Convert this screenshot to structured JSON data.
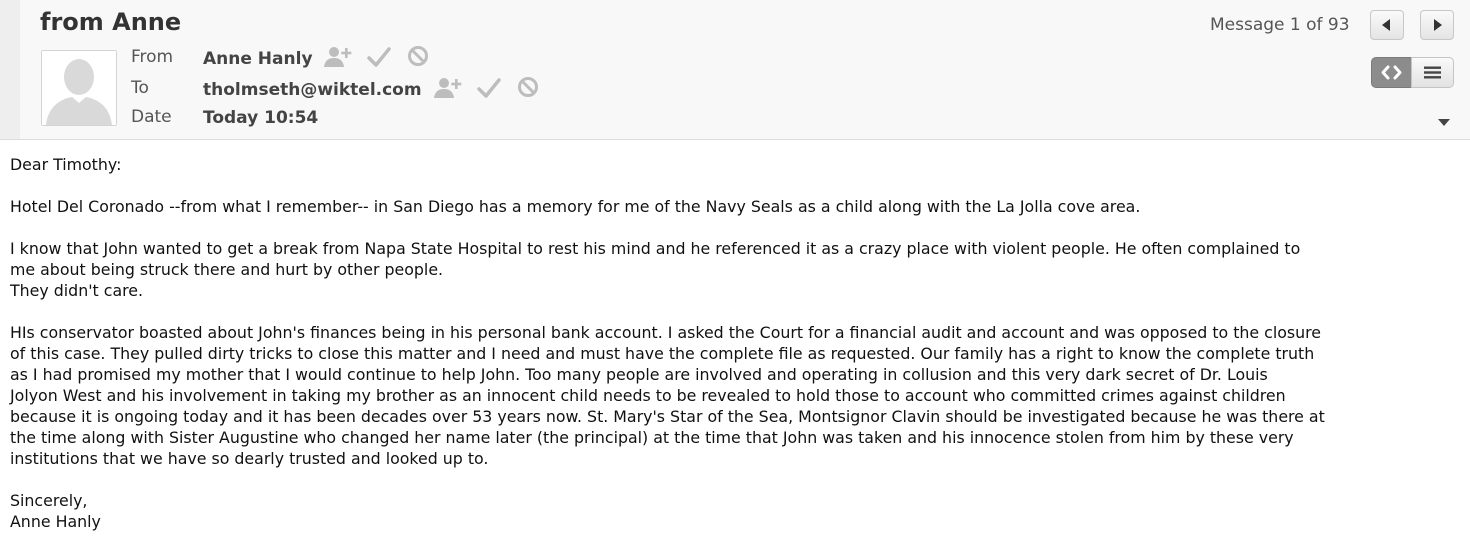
{
  "message": {
    "subject": "from Anne",
    "from_label": "From",
    "from_name": "Anne Hanly",
    "to_label": "To",
    "to_address": "tholmseth@wiktel.com",
    "date_label": "Date",
    "date_value": "Today 10:54"
  },
  "navigation": {
    "counter": "Message 1 of 93",
    "prev_icon": "triangle-left-icon",
    "next_icon": "triangle-right-icon"
  },
  "view_toggle": {
    "left_icon": "code-brackets-icon",
    "right_icon": "lines-icon",
    "active": "left"
  },
  "contact_icons": [
    "add-contact-icon",
    "checkmark-icon",
    "block-icon"
  ],
  "expand_icon": "caret-down-icon",
  "body": {
    "greeting": "Dear Timothy:",
    "para1": "Hotel Del Coronado --from what I remember-- in San Diego has a memory for me of the Navy Seals as a child along with the La Jolla cove area.",
    "para2_lines": [
      "I know that John wanted to get a break from Napa State Hospital to rest his mind and he referenced it as a crazy place with violent people.  He often complained to",
      "me about being struck there and hurt by other people.",
      "They didn't care."
    ],
    "para3_lines": [
      "HIs conservator boasted about John's finances being in his personal bank account.  I asked the Court for a financial audit and account and was opposed to the closure",
      "of this case.  They pulled dirty tricks to close this matter and I need and must have the complete file as requested.  Our family has a right to know the complete truth",
      "as I had promised my mother that I would continue to help John.  Too many people are involved and operating in collusion and this very dark secret of Dr. Louis",
      "Jolyon West and his involvement in taking my brother as an innocent child needs to be revealed to hold those to account who committed crimes against children",
      "because it is ongoing today and it has been decades over 53 years now.  St. Mary's Star of the Sea, Montsignor Clavin should be investigated because he was there at",
      "the time along with Sister Augustine who changed her name later (the principal) at the time that John was taken and his innocence stolen from him by these very",
      "institutions that we have so dearly trusted and looked up to."
    ],
    "closing": "Sincerely,",
    "signature": "Anne Hanly"
  }
}
